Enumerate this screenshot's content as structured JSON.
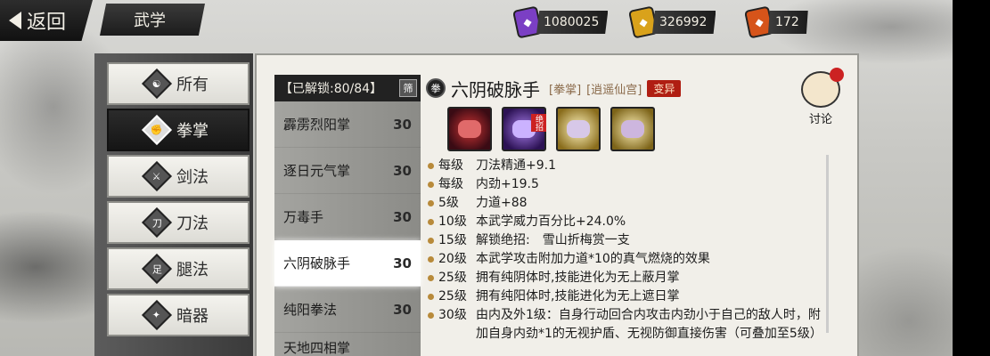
{
  "header": {
    "back_label": "返回",
    "page_title": "武学"
  },
  "currencies": [
    {
      "icon": "purple-token-icon",
      "value": "1080025",
      "color": "#7b3fc4"
    },
    {
      "icon": "gold-token-icon",
      "value": "326992",
      "color": "#d9a21b"
    },
    {
      "icon": "fire-token-icon",
      "value": "172",
      "color": "#d6541a"
    }
  ],
  "sidebar": {
    "items": [
      {
        "label": "所有",
        "icon": "all-icon",
        "glyph": "☯"
      },
      {
        "label": "拳掌",
        "icon": "fist-icon",
        "glyph": "✊"
      },
      {
        "label": "剑法",
        "icon": "sword-icon",
        "glyph": "⚔"
      },
      {
        "label": "刀法",
        "icon": "blade-icon",
        "glyph": "刀"
      },
      {
        "label": "腿法",
        "icon": "kick-icon",
        "glyph": "足"
      },
      {
        "label": "暗器",
        "icon": "dart-icon",
        "glyph": "✦"
      }
    ],
    "active_index": 1
  },
  "skill_list": {
    "header": "【已解锁:80/84】",
    "filter_label": "筛",
    "items": [
      {
        "name": "霹雳烈阳掌",
        "level": "30"
      },
      {
        "name": "逐日元气掌",
        "level": "30"
      },
      {
        "name": "万毒手",
        "level": "30"
      },
      {
        "name": "六阴破脉手",
        "level": "30"
      },
      {
        "name": "纯阳拳法",
        "level": "30"
      },
      {
        "name": "天地四相掌",
        "level": ""
      }
    ],
    "active_index": 3
  },
  "detail": {
    "type_glyph": "拳",
    "name": "六阴破脉手",
    "tag_type": "[拳掌]",
    "tag_sect": "[逍遥仙宫]",
    "mutate_label": "变异",
    "discuss_label": "讨论",
    "moves": [
      {
        "icon": "red-fist-move-icon",
        "color": "#8e1c2a",
        "ultimate": false
      },
      {
        "icon": "purple-claw-move-icon",
        "color": "#6b3bc9",
        "ultimate": true
      },
      {
        "icon": "gold-fist-move-icon",
        "color": "#d8b94a",
        "ultimate": false
      },
      {
        "icon": "gold-palm-move-icon",
        "color": "#cfae48",
        "ultimate": false
      }
    ],
    "ultimate_label": "绝招",
    "effects": [
      {
        "level": "每级",
        "text": "刀法精通+9.1"
      },
      {
        "level": "每级",
        "text": "内劲+19.5"
      },
      {
        "level": "5级",
        "text": "力道+88"
      },
      {
        "level": "10级",
        "text": "本武学威力百分比+24.0%"
      },
      {
        "level": "15级",
        "text": "解锁绝招:　雪山折梅赏一支"
      },
      {
        "level": "20级",
        "text": "本武学攻击附加力道*10的真气燃烧的效果"
      },
      {
        "level": "25级",
        "text": "拥有纯阴体时,技能进化为无上蔽月掌"
      },
      {
        "level": "25级",
        "text": "拥有纯阳体时,技能进化为无上遮日掌"
      },
      {
        "level": "30级",
        "text": "由内及外1级：自身行动回合内攻击内劲小于自己的敌人时，附加自身内劲*1的无视护盾、无视防御直接伤害（可叠加至5级）"
      }
    ]
  }
}
